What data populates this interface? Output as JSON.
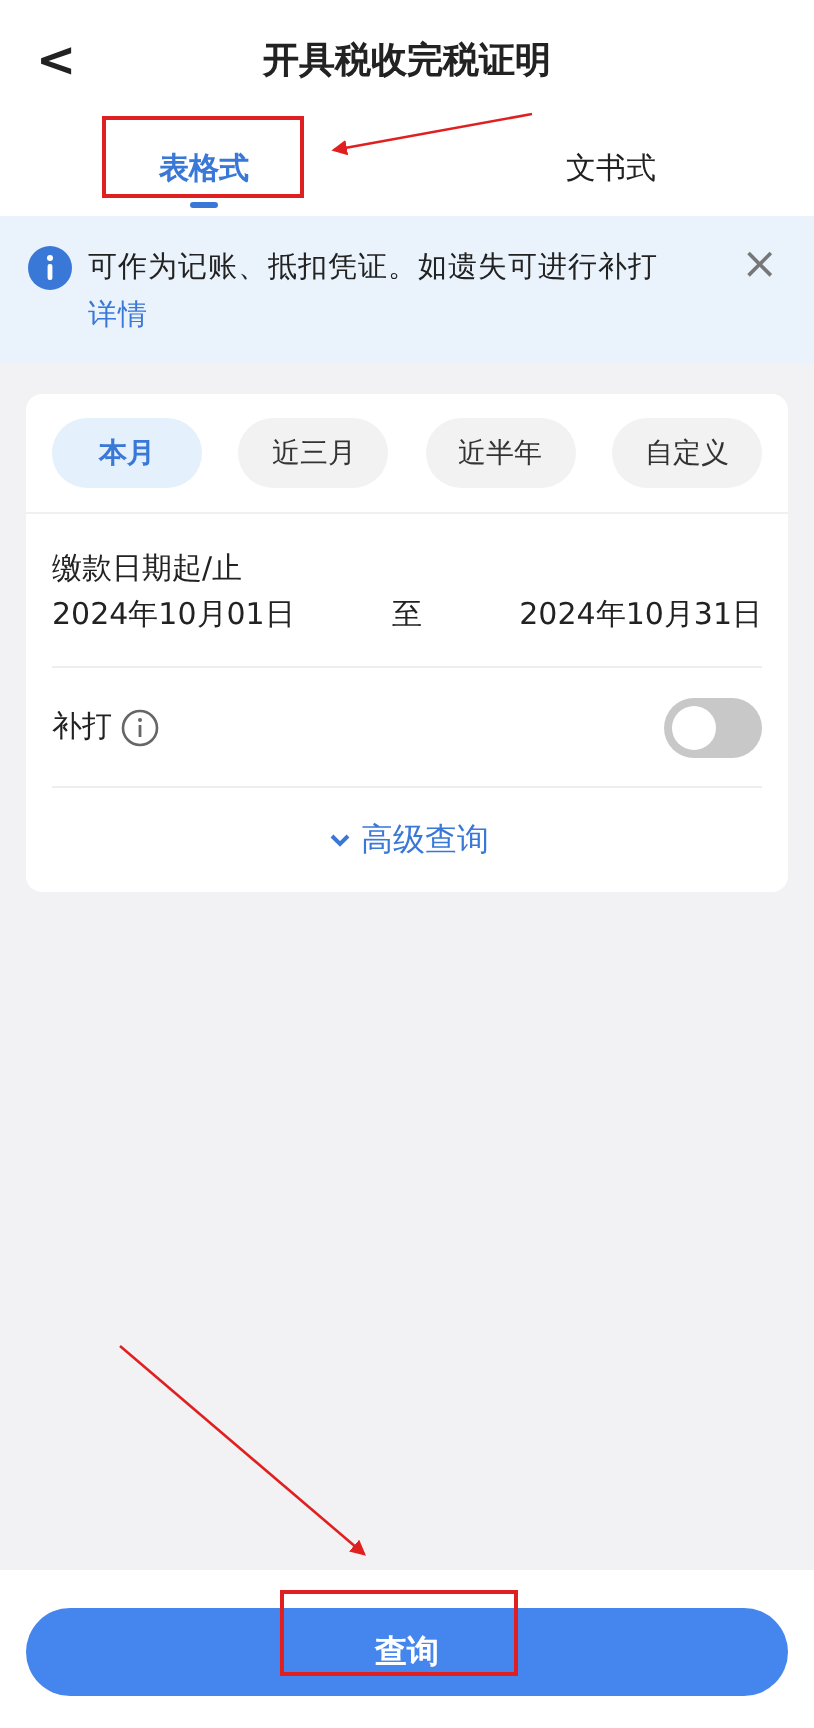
{
  "header": {
    "back": "<",
    "title": "开具税收完税证明"
  },
  "tabs": [
    {
      "label": "表格式",
      "selected": true
    },
    {
      "label": "文书式",
      "selected": false
    }
  ],
  "notice": {
    "text": "可作为记账、抵扣凭证。如遗失可进行补打",
    "link": "详情",
    "close": "×"
  },
  "periods": [
    {
      "label": "本月",
      "selected": true
    },
    {
      "label": "近三月",
      "selected": false
    },
    {
      "label": "近半年",
      "selected": false
    },
    {
      "label": "自定义",
      "selected": false
    }
  ],
  "date_range": {
    "label": "缴款日期起/止",
    "start": "2024年10月01日",
    "separator": "至",
    "end": "2024年10月31日"
  },
  "reprint": {
    "label": "补打",
    "on": false
  },
  "advanced": {
    "label": "高级查询",
    "expanded": false
  },
  "submit": {
    "label": "查询"
  }
}
